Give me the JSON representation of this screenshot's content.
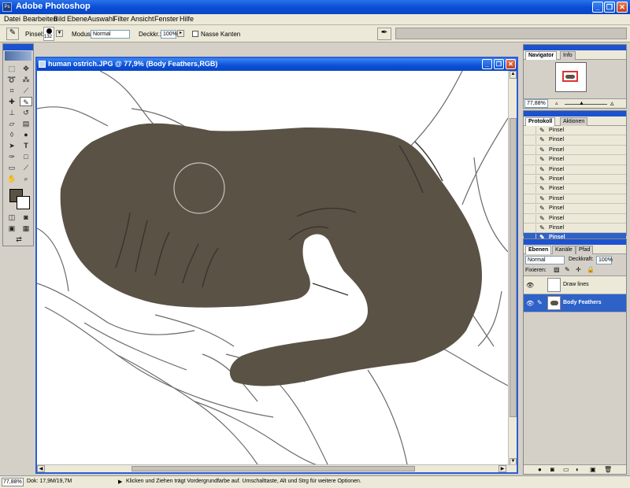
{
  "app": {
    "title": "Adobe Photoshop",
    "icon_text": "Ps",
    "window_buttons": [
      "_",
      "❐",
      "✕"
    ]
  },
  "menu": [
    "Datei",
    "Bearbeiten",
    "Bild",
    "Ebene",
    "Auswahl",
    "Filter",
    "Ansicht",
    "Fenster",
    "Hilfe"
  ],
  "options": {
    "brush_label": "Pinsel:",
    "brush_size": "132",
    "mode_label": "Modus:",
    "mode_value": "Normal",
    "opacity_label": "Deckkr.:",
    "opacity_value": "100%",
    "wet_edges_label": "Nasse Kanten"
  },
  "document": {
    "title": "human ostrich.JPG @ 77,9% (Body Feathers,RGB)",
    "fill_color": "#5a5245"
  },
  "navigator": {
    "tabs": [
      "Navigator",
      "Info"
    ],
    "zoom": "77,88%"
  },
  "history": {
    "tabs": [
      "Protokoll",
      "Aktionen"
    ],
    "items": [
      "Pinsel",
      "Pinsel",
      "Pinsel",
      "Pinsel",
      "Pinsel",
      "Pinsel",
      "Pinsel",
      "Pinsel",
      "Pinsel",
      "Pinsel",
      "Pinsel"
    ],
    "selected": "Pinsel"
  },
  "layers": {
    "tabs": [
      "Ebenen",
      "Kanäle",
      "Pfad"
    ],
    "blend_mode": "Normal",
    "opacity_label": "Deckkraft:",
    "opacity_value": "100%",
    "lock_label": "Fixieren:",
    "items": [
      {
        "name": "Draw lines"
      },
      {
        "name": "Body Feathers"
      }
    ]
  },
  "status": {
    "zoom": "77,88%",
    "doc_size": "Dok: 17,9M/19,7M",
    "hint": "Klicken und Ziehen trägt Vordergrundfarbe auf. Umschalttaste, Alt und Strg für weitere Optionen."
  }
}
